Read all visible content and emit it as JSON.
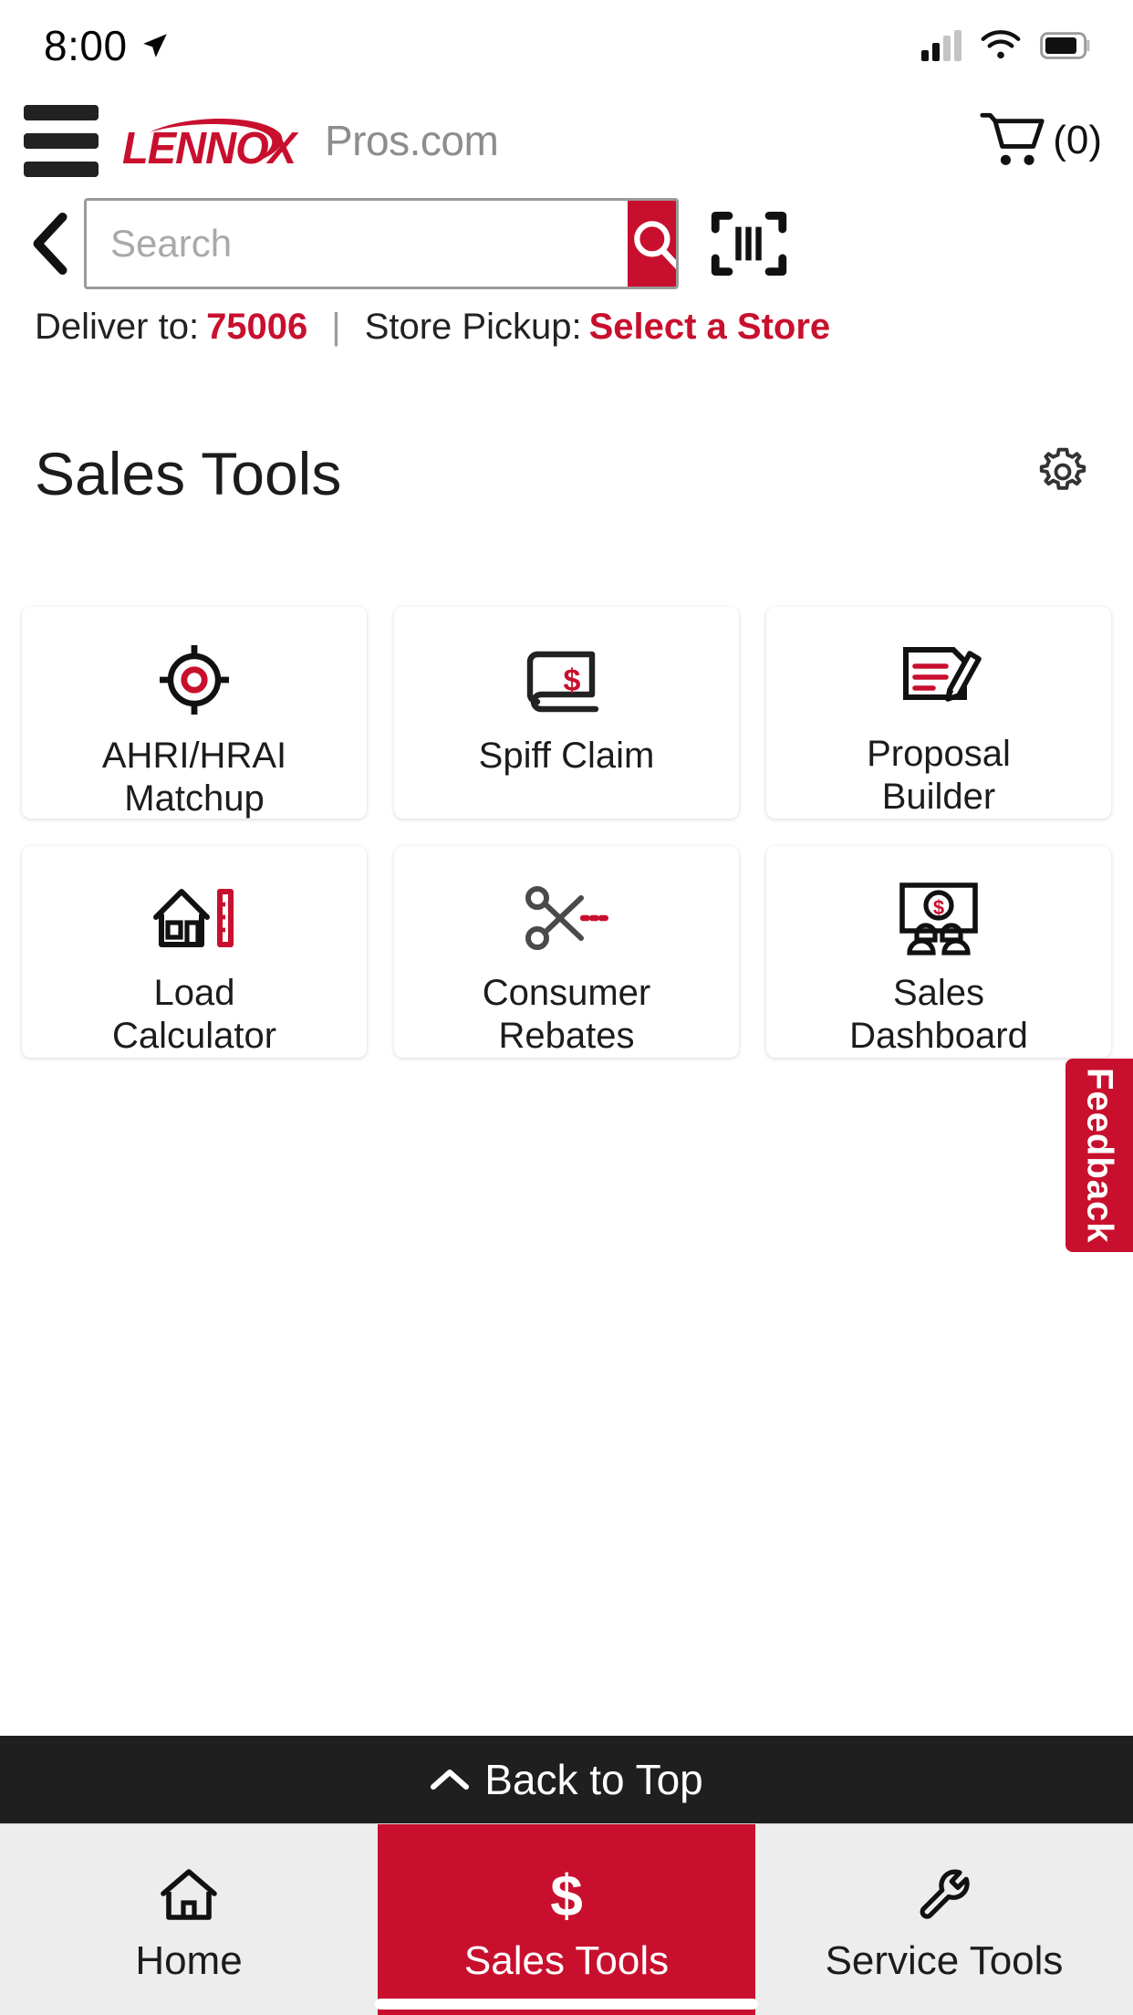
{
  "status_bar": {
    "time": "8:00",
    "location_icon": "location-arrow-icon",
    "signal_icon": "cellular-signal-icon",
    "wifi_icon": "wifi-icon",
    "battery_icon": "battery-icon"
  },
  "header": {
    "menu_icon": "hamburger-menu-icon",
    "logo_text": "LENNOX",
    "logo_suffix": "Pros.com",
    "cart_icon": "shopping-cart-icon",
    "cart_count": "(0)"
  },
  "search": {
    "back_icon": "back-chevron-icon",
    "placeholder": "Search",
    "value": "",
    "search_icon": "magnifier-icon",
    "barcode_icon": "barcode-scanner-icon"
  },
  "delivery": {
    "deliver_label": "Deliver to:",
    "deliver_value": "75006",
    "separator": "|",
    "pickup_label": "Store Pickup:",
    "pickup_value": "Select a Store"
  },
  "page": {
    "title": "Sales Tools",
    "settings_icon": "gear-icon"
  },
  "tools": [
    {
      "label": "AHRI/HRAI\nMatchup",
      "line1": "AHRI/HRAI",
      "line2": "Matchup",
      "icon": "target-crosshair-icon"
    },
    {
      "label": "Spiff Claim",
      "line1": "Spiff Claim",
      "line2": "",
      "icon": "money-banner-dollar-icon"
    },
    {
      "label": "Proposal Builder",
      "line1": "Proposal",
      "line2": "Builder",
      "icon": "document-pencil-icon"
    },
    {
      "label": "Load Calculator",
      "line1": "Load",
      "line2": "Calculator",
      "icon": "house-ruler-icon"
    },
    {
      "label": "Consumer Rebates",
      "line1": "Consumer",
      "line2": "Rebates",
      "icon": "scissors-coupon-icon"
    },
    {
      "label": "Sales Dashboard",
      "line1": "Sales",
      "line2": "Dashboard",
      "icon": "presentation-board-people-dollar-icon"
    }
  ],
  "feedback": {
    "label": "Feedback"
  },
  "back_to_top": {
    "label": "Back to Top",
    "icon": "chevron-up-icon"
  },
  "bottom_nav": [
    {
      "label": "Home",
      "icon": "home-icon",
      "active": false
    },
    {
      "label": "Sales Tools",
      "icon": "dollar-sign-icon",
      "active": true
    },
    {
      "label": "Service Tools",
      "icon": "wrench-icon",
      "active": false
    }
  ],
  "colors": {
    "brand_red": "#c8102e",
    "dark_bar": "#1f1f1f",
    "nav_bg": "#ededed",
    "text": "#1c1c1c",
    "muted": "#8d8d8d"
  }
}
